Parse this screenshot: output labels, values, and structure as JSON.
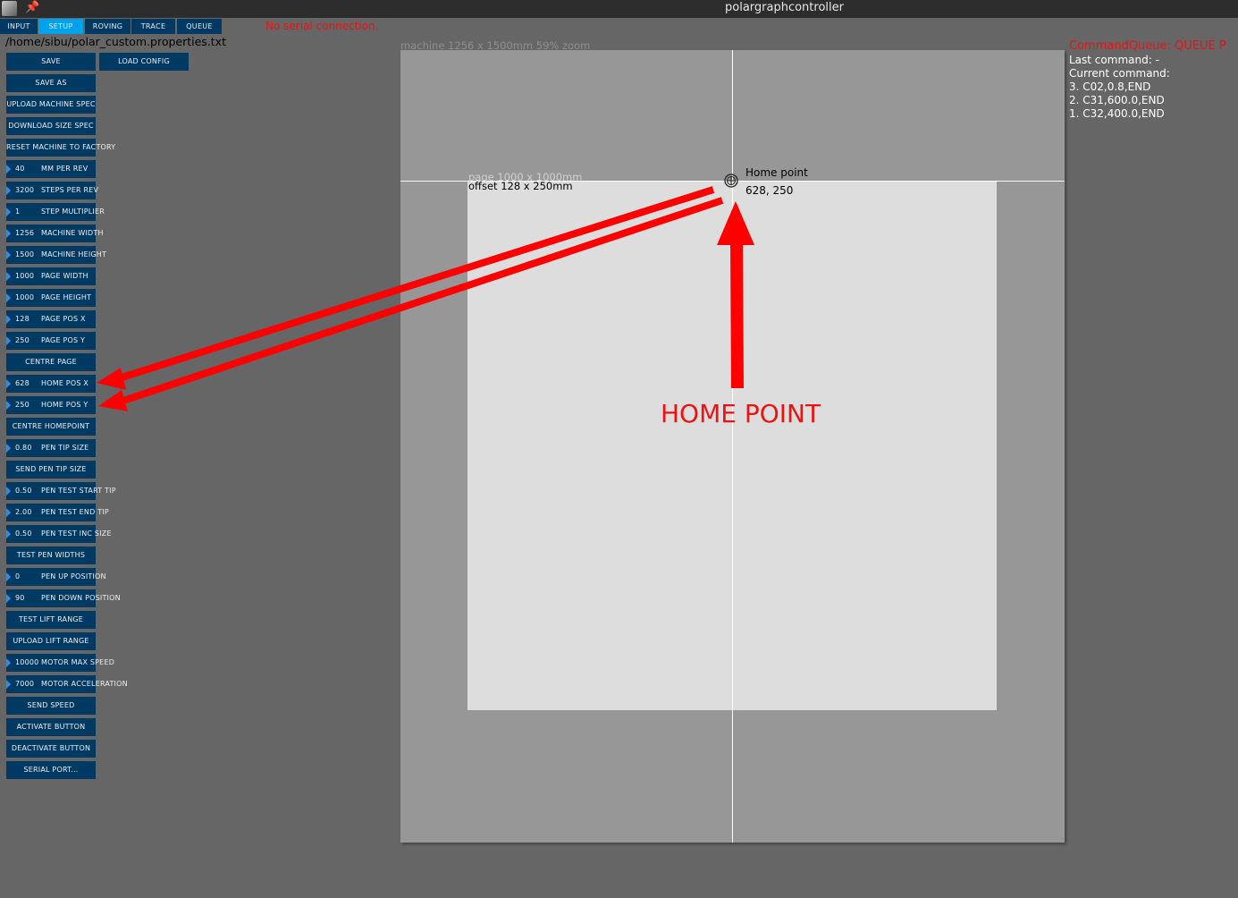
{
  "window": {
    "title": "polargraphcontroller"
  },
  "tabs": [
    {
      "label": "INPUT",
      "active": false
    },
    {
      "label": "SETUP",
      "active": true
    },
    {
      "label": "ROVING",
      "active": false
    },
    {
      "label": "TRACE",
      "active": false
    },
    {
      "label": "QUEUE",
      "active": false
    }
  ],
  "status": {
    "serial": "No serial connection."
  },
  "setup": {
    "file_path": "/home/sibu/polar_custom.properties.txt",
    "save": "SAVE",
    "load_config": "LOAD CONFIG",
    "save_as": "SAVE AS",
    "upload_machine_spec": "UPLOAD MACHINE SPEC",
    "download_size_spec": "DOWNLOAD SIZE SPEC",
    "reset_machine": "RESET MACHINE TO FACTORY",
    "mm_per_rev": {
      "value": "40",
      "label": "MM PER REV"
    },
    "steps_per_rev": {
      "value": "3200",
      "label": "STEPS PER REV"
    },
    "step_multiplier": {
      "value": "1",
      "label": "STEP MULTIPLIER"
    },
    "machine_width": {
      "value": "1256",
      "label": "MACHINE WIDTH"
    },
    "machine_height": {
      "value": "1500",
      "label": "MACHINE HEIGHT"
    },
    "page_width": {
      "value": "1000",
      "label": "PAGE WIDTH"
    },
    "page_height": {
      "value": "1000",
      "label": "PAGE HEIGHT"
    },
    "page_pos_x": {
      "value": "128",
      "label": "PAGE POS X"
    },
    "page_pos_y": {
      "value": "250",
      "label": "PAGE POS Y"
    },
    "centre_page": "CENTRE PAGE",
    "home_pos_x": {
      "value": "628",
      "label": "HOME POS X"
    },
    "home_pos_y": {
      "value": "250",
      "label": "HOME POS Y"
    },
    "centre_homepoint": "CENTRE HOMEPOINT",
    "pen_tip_size": {
      "value": "0.80",
      "label": "PEN TIP SIZE"
    },
    "send_pen_tip_size": "SEND PEN TIP SIZE",
    "pen_test_start_tip": {
      "value": "0.50",
      "label": "PEN TEST START TIP"
    },
    "pen_test_end_tip": {
      "value": "2.00",
      "label": "PEN TEST END TIP"
    },
    "pen_test_inc_size": {
      "value": "0.50",
      "label": "PEN TEST INC SIZE"
    },
    "test_pen_widths": "TEST PEN WIDTHS",
    "pen_up_position": {
      "value": "0",
      "label": "PEN UP POSITION"
    },
    "pen_down_position": {
      "value": "90",
      "label": "PEN DOWN POSITION"
    },
    "test_lift_range": "TEST LIFT RANGE",
    "upload_lift_range": "UPLOAD LIFT RANGE",
    "motor_max_speed": {
      "value": "10000",
      "label": "MOTOR MAX SPEED"
    },
    "motor_acceleration": {
      "value": "7000",
      "label": "MOTOR ACCELERATION"
    },
    "send_speed": "SEND SPEED",
    "activate_button": "ACTIVATE BUTTON",
    "deactivate_button": "DEACTIVATE BUTTON",
    "serial_port": "SERIAL PORT..."
  },
  "canvas": {
    "machine_label": "machine 1256 x 1500mm 59% zoom",
    "page_label": "page 1000 x 1000mm",
    "offset_label": "offset 128 x 250mm",
    "home_label": "Home point",
    "home_coords": "628, 250"
  },
  "command_queue": {
    "title": "CommandQueue: QUEUE P",
    "last_command": "Last command: -",
    "current_command": "Current command:",
    "items": [
      "3. C02,0.8,END",
      "2. C31,600.0,END",
      "1. C32,400.0,END"
    ]
  },
  "annotation": {
    "text": "HOME POINT",
    "color": "#ee1111"
  },
  "colors": {
    "button_bg": "#003a63",
    "active_tab": "#00a2ee",
    "background": "#666666",
    "machine": "#979797",
    "page": "#dddddd"
  }
}
